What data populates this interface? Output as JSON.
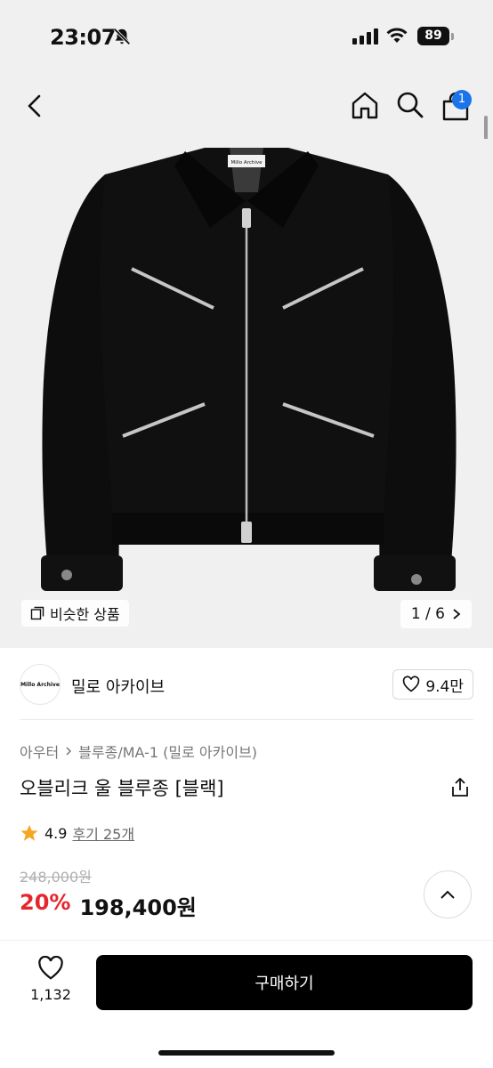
{
  "status": {
    "time": "23:07",
    "battery": "89"
  },
  "nav": {
    "cart_count": "1"
  },
  "gallery": {
    "similar_label": "비슷한 상품",
    "page_indicator": "1 / 6",
    "label_tag": "Millo Archive"
  },
  "brand": {
    "logo_text": "Millo Archive",
    "name": "밀로 아카이브",
    "likes": "9.4만"
  },
  "product": {
    "breadcrumb_1": "아우터",
    "breadcrumb_2": "블루종/MA-1 (밀로 아카이브)",
    "title": "오블리크 울 블루종 [블랙]",
    "rating": "4.9",
    "review_label": "후기 25개",
    "original_price": "248,000원",
    "discount": "20%",
    "price": "198,400원"
  },
  "bottom": {
    "wish_count": "1,132",
    "buy_label": "구매하기"
  },
  "colors": {
    "discount": "#e5262d",
    "badge": "#1a73e8",
    "star": "#f5a623"
  }
}
